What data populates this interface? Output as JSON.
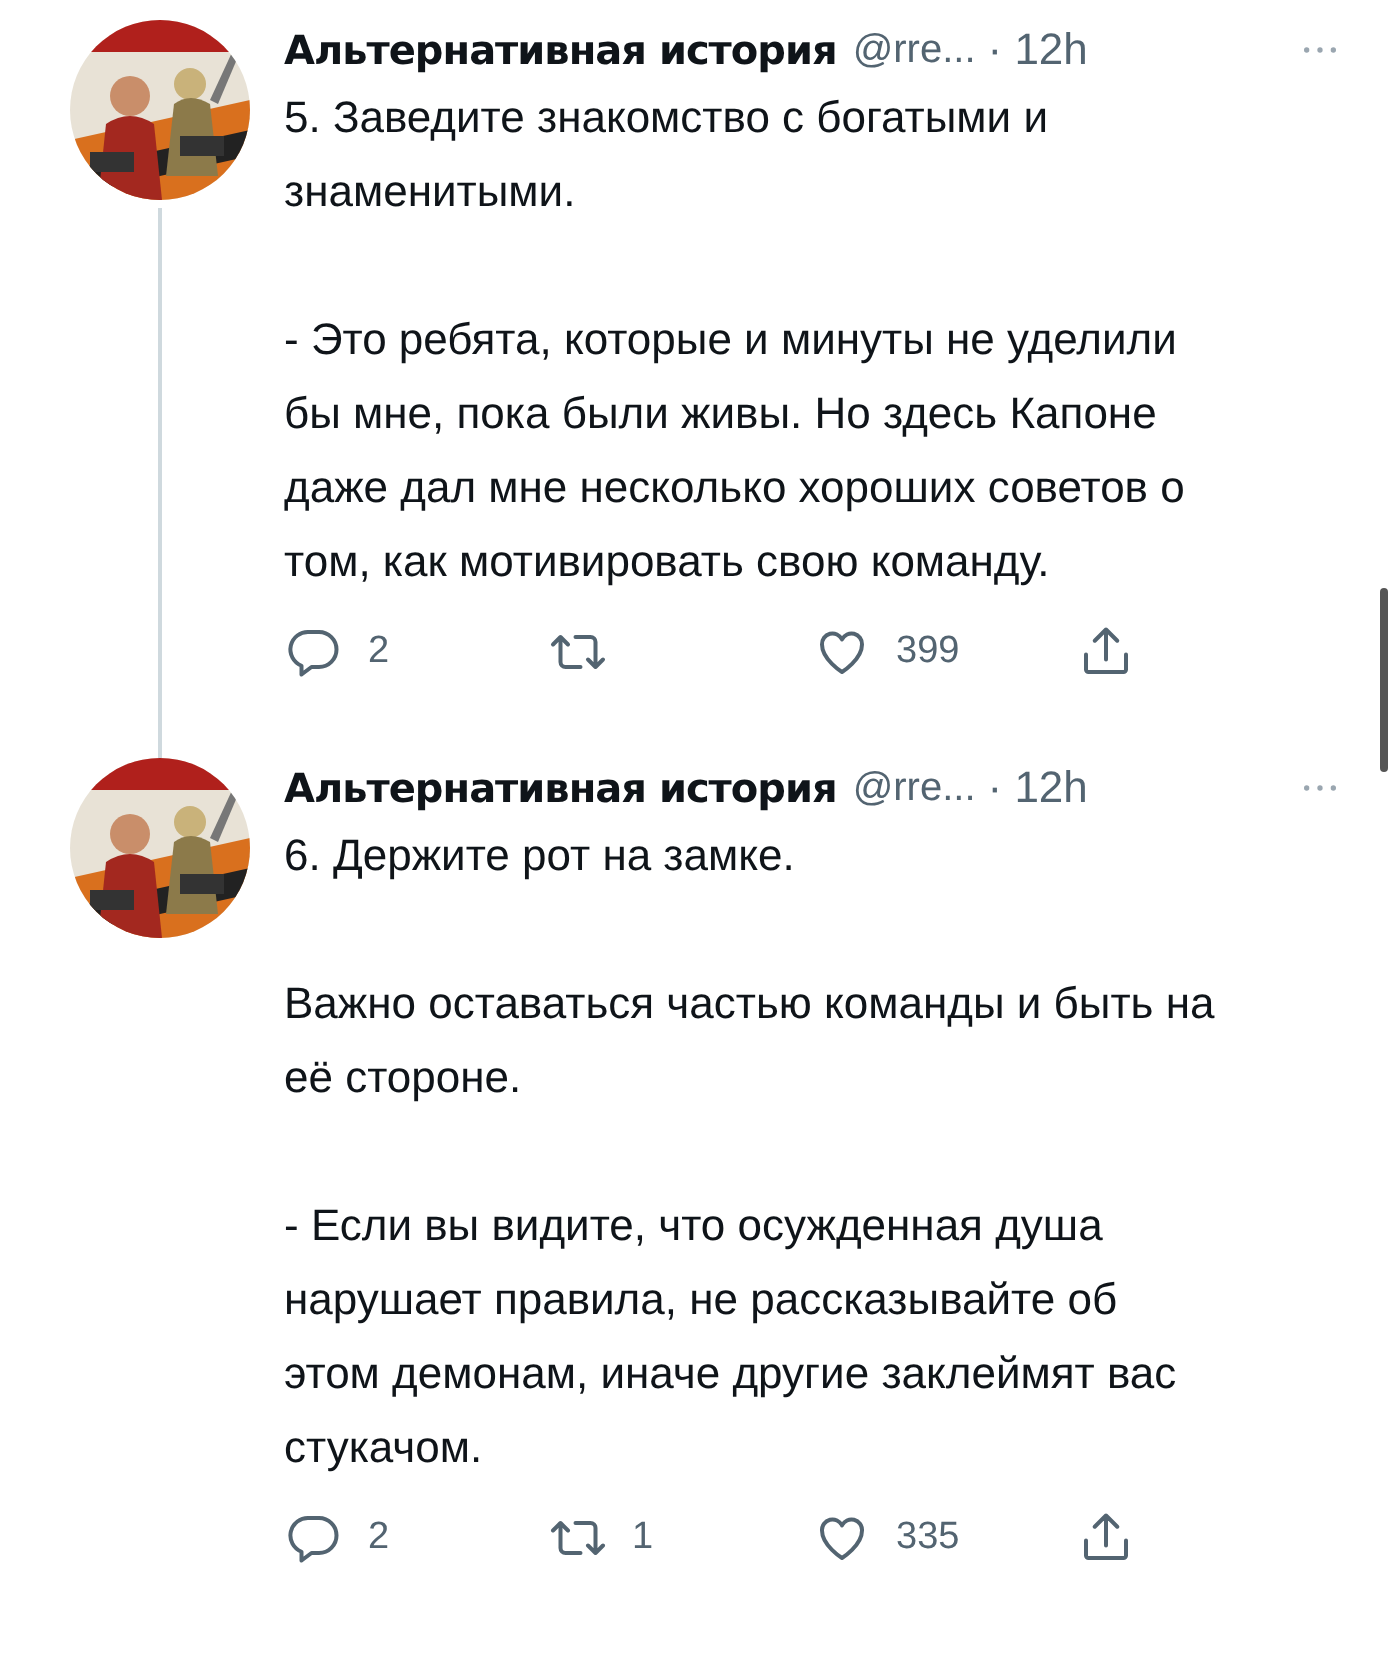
{
  "tweets": [
    {
      "name": "Альтернативная история",
      "handle": "@rre...",
      "time": "· 12h",
      "thread_line": true,
      "paragraphs": [
        "5. Заведите знакомство с богатыми и знаменитыми.",
        "- Это ребята, которые и минуты не уделили бы мне, пока были живы. Но здесь Капоне даже дал мне несколько хороших советов о том, как мотивировать свою команду."
      ],
      "replies": "2",
      "likes": "399"
    },
    {
      "name": "Альтернативная история",
      "handle": "@rre...",
      "time": "· 12h",
      "thread_line": false,
      "paragraphs": [
        "6. Держите рот на замке.",
        "Важно оставаться частью команды и быть на её стороне.",
        "- Если вы видите, что осужденная душа нарушает правила, не рассказывайте об этом демонам, иначе другие заклеймят вас стукачом."
      ],
      "replies": "2",
      "retweets": "1",
      "likes": "335"
    }
  ]
}
